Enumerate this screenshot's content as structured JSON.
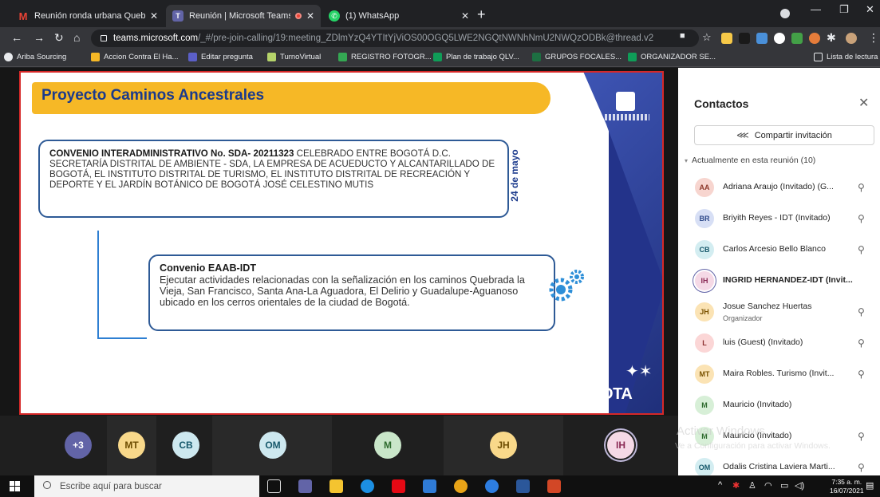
{
  "browser": {
    "tabs": [
      {
        "title": "Reunión ronda urbana Quebrada",
        "favicon": "gmail-icon",
        "active": false
      },
      {
        "title": "Reunión | Microsoft Teams",
        "favicon": "teams-icon",
        "active": true
      },
      {
        "title": "(1) WhatsApp",
        "favicon": "whatsapp-icon",
        "active": false
      }
    ],
    "url_host": "teams.microsoft.com",
    "url_path": "/_#/pre-join-calling/19:meeting_ZDlmYzQ4YTItYjViOS00OGQ5LWE2NGQtNWNhNmU2NWQzODBk@thread.v2",
    "bookmarks": [
      "Ariba Sourcing",
      "Accion Contra El Ha...",
      "Editar pregunta",
      "TurnoVirtual",
      "REGISTRO FOTOGR...",
      "Plan de trabajo QLV...",
      "GRUPOS FOCALES...",
      "ORGANIZADOR SE..."
    ],
    "reading_list": "Lista de lectura"
  },
  "slide": {
    "title": "Proyecto Caminos Ancestrales",
    "convenio_lead": "CONVENIO INTERADMINISTRATIVO No. SDA- 20211323",
    "convenio_text": " CELEBRADO ENTRE BOGOTÁ D.C. SECRETARÍA DISTRITAL DE AMBIENTE - SDA, LA EMPRESA DE ACUEDUCTO Y ALCANTARILLADO DE BOGOTÁ, EL INSTITUTO DISTRITAL DE TURISMO, EL INSTITUTO DISTRITAL DE RECREACIÓN Y DEPORTE Y EL JARDÍN BOTÁNICO DE BOGOTÁ JOSÉ CELESTINO MUTIS",
    "date": "24 de mayo",
    "eaab_title": "Convenio EAAB-IDT",
    "eaab_text": "Ejecutar actividades relacionadas con la  señalización en los caminos Quebrada la Vieja, San Francisco, Santa Ana-La Aguadora, El Delirio y Guadalupe-Aguanoso ubicado en los cerros orientales de la ciudad de Bogotá.",
    "brand": "BOGOTA"
  },
  "strip": {
    "tiles": [
      {
        "initials": "+3",
        "bg": "#6264a7",
        "fg": "#ffffff"
      },
      {
        "initials": "MT",
        "bg": "#f8d88a",
        "fg": "#6d4c00"
      },
      {
        "initials": "CB",
        "bg": "#cde8ef",
        "fg": "#16586b"
      },
      {
        "initials": "OM",
        "bg": "#cde8ef",
        "fg": "#16586b"
      },
      {
        "initials": "M",
        "bg": "#c9e6c9",
        "fg": "#2d6a2d"
      },
      {
        "initials": "JH",
        "bg": "#f8d88a",
        "fg": "#6d4c00"
      },
      {
        "initials": "IH",
        "bg": "#f5d9e6",
        "fg": "#8a2a55"
      }
    ]
  },
  "panel": {
    "title": "Contactos",
    "share_label": "Compartir invitación",
    "section_label": "Actualmente en esta reunión (10)",
    "people": [
      {
        "initials": "AA",
        "name": "Adriana Araujo (Invitado) (G...",
        "role": "",
        "bg": "#f7d5cf",
        "fg": "#8e3a2c",
        "mic_off": true
      },
      {
        "initials": "BR",
        "name": "Briyith Reyes - IDT (Invitado)",
        "role": "",
        "bg": "#d7dff5",
        "fg": "#2f4a8a",
        "mic_off": true
      },
      {
        "initials": "CB",
        "name": "Carlos Arcesio Bello Blanco",
        "role": "",
        "bg": "#d3edf1",
        "fg": "#16586b",
        "mic_off": true
      },
      {
        "initials": "IH",
        "name": "INGRID HERNANDEZ-IDT (Invit...",
        "role": "",
        "bg": "#f5d9e6",
        "fg": "#8a2a55",
        "mic_off": false,
        "active": true
      },
      {
        "initials": "JH",
        "name": "Josue Sanchez Huertas",
        "role": "Organizador",
        "bg": "#fbe3b4",
        "fg": "#7a5200",
        "mic_off": true
      },
      {
        "initials": "L",
        "name": "luis (Guest) (Invitado)",
        "role": "",
        "bg": "#fbd6d6",
        "fg": "#8a2b2b",
        "mic_off": true
      },
      {
        "initials": "MT",
        "name": "Maira Robles. Turismo (Invit...",
        "role": "",
        "bg": "#fbe3b4",
        "fg": "#7a5200",
        "mic_off": true
      },
      {
        "initials": "M",
        "name": "Mauricio (Invitado)",
        "role": "",
        "bg": "#d7efd7",
        "fg": "#2d6a2d",
        "mic_off": false
      },
      {
        "initials": "M",
        "name": "Mauricio (Invitado)",
        "role": "",
        "bg": "#d7efd7",
        "fg": "#2d6a2d",
        "mic_off": true
      },
      {
        "initials": "OM",
        "name": "Odalis Cristina Laviera Marti...",
        "role": "",
        "bg": "#d3edf1",
        "fg": "#16586b",
        "mic_off": true
      }
    ]
  },
  "watermark": {
    "title": "Activar Windows",
    "subtitle": "Ve a Configuración para activar Windows."
  },
  "taskbar": {
    "search_placeholder": "Escribe aquí para buscar",
    "time": "7:35 a. m.",
    "date": "16/07/2021"
  }
}
